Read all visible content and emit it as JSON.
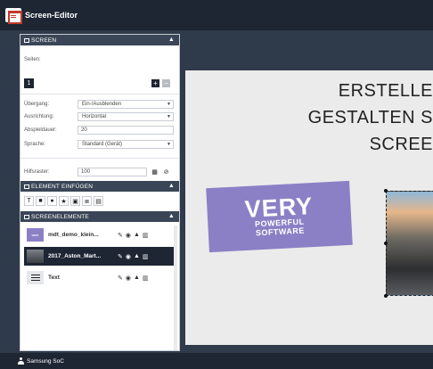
{
  "app": {
    "title": "Screen-Editor"
  },
  "screen_section": {
    "header": "SCREEN",
    "pages_label": "Seiten:",
    "current_page": "1",
    "add_page": "+",
    "remove_page": "−",
    "fields": [
      {
        "label": "Übergang:",
        "value": "Ein-/Ausblenden",
        "type": "select"
      },
      {
        "label": "Ausrichtung:",
        "value": "Horizontal",
        "type": "select"
      },
      {
        "label": "Abspieldauer:",
        "value": "20",
        "type": "input"
      },
      {
        "label": "Sprache:",
        "value": "Standard (Gerät)",
        "type": "select"
      }
    ],
    "grid_label": "Hilfsraster:",
    "grid_value": "100"
  },
  "element_section": {
    "header": "ELEMENT EINFÜGEN",
    "tools": [
      "text-tool-icon",
      "rectangle-tool-icon",
      "circle-tool-icon",
      "star-tool-icon",
      "image-tool-icon",
      "list-tool-icon",
      "table-tool-icon"
    ],
    "tool_glyphs": [
      "T",
      "■",
      "●",
      "★",
      "▣",
      "≣",
      "▤"
    ]
  },
  "elements_section": {
    "header": "SCREENELEMENTE",
    "items": [
      {
        "name": "mdt_demo_klein...",
        "thumb": "very",
        "thumb_text": "VERY",
        "selected": false
      },
      {
        "name": "2017_Aston_Mart...",
        "thumb": "car",
        "thumb_text": "",
        "selected": true
      },
      {
        "name": "Text",
        "thumb": "text",
        "thumb_text": "",
        "selected": false
      }
    ]
  },
  "canvas": {
    "headline_lines": [
      "ERSTELLE",
      "GESTALTEN S",
      "SCREE"
    ],
    "card": {
      "big": "VERY",
      "line1": "POWERFUL",
      "line2": "SOFTWARE"
    }
  },
  "status": {
    "device": "Samsung SoC"
  },
  "colors": {
    "dark": "#1e2533",
    "panel_header": "#3a4657",
    "accent_purple": "#8b80c6",
    "brand_red": "#c0392b"
  }
}
